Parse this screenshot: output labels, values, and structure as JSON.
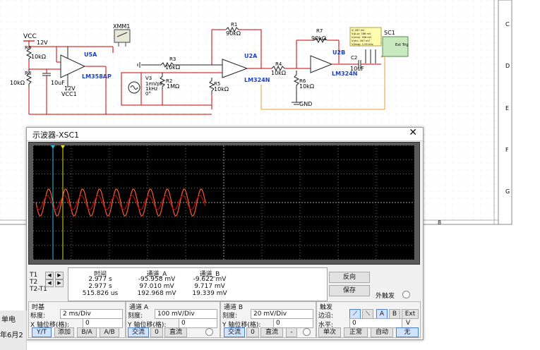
{
  "schematic": {
    "vcc_label": "VCC",
    "vcc_voltage": "12V",
    "r9": {
      "name": "R9",
      "value": "10kΩ"
    },
    "r8": {
      "name": "R8",
      "value": "10kΩ"
    },
    "c1": {
      "name": "C1",
      "value": "10uF"
    },
    "vcc1": {
      "voltage": "12V",
      "label": "VCC1"
    },
    "u5a": {
      "name": "U5A",
      "part": "LM358AP"
    },
    "xmm1": "XMM1",
    "r3": {
      "name": "R3",
      "value": "10kΩ"
    },
    "v3": {
      "name": "V3",
      "line1": "1mVpk",
      "line2": "1kHz",
      "line3": "0°"
    },
    "r2": {
      "name": "R2",
      "value": "1MΩ"
    },
    "r1": {
      "name": "R1",
      "value": "90kΩ"
    },
    "u2a": {
      "name": "U2A",
      "part": "LM324N"
    },
    "r5": {
      "name": "R5",
      "value": "10kΩ"
    },
    "r4": {
      "name": "R4",
      "value": "10kΩ"
    },
    "r7": {
      "name": "R7",
      "value": "90kΩ"
    },
    "u2b": {
      "name": "U2B",
      "part": "LM324N"
    },
    "r6": {
      "name": "R6",
      "value": "10kΩ"
    },
    "c2": {
      "name": "C2",
      "value": "10uF"
    },
    "gnd": "GND",
    "sc1": "SC1",
    "probe_lines": [
      "V: 267 mV",
      "V(p-p): 186 mV",
      "V(rms): 306 mV",
      "V(dc): 267 mV",
      "V(freq): 1.00 kHz"
    ],
    "ext_trig": "Ext Trig",
    "border_letters": [
      "C",
      "D",
      "E",
      "F",
      "G"
    ],
    "border_number": "8"
  },
  "scope": {
    "title": "示波器-XSC1",
    "close_icon": "✕",
    "cursor_colors": {
      "t1": "#20c8e8",
      "t2": "#e8e020"
    },
    "trace_colors": {
      "a": "#ff5a2a",
      "b": "#b01010"
    },
    "readout": {
      "headers": {
        "time": "时间",
        "ch_a": "通道_A",
        "ch_b": "通道_B"
      },
      "rows": [
        {
          "label": "T1",
          "time": "2.977 s",
          "a": "-95.958 mV",
          "b": "-9.622 mV"
        },
        {
          "label": "T2",
          "time": "2.977 s",
          "a": "97.010 mV",
          "b": "9.717 mV"
        },
        {
          "label": "T2-T1",
          "time": "515.826 us",
          "a": "192.968 mV",
          "b": "19.339 mV"
        }
      ]
    },
    "buttons": {
      "reverse": "反向",
      "save": "保存"
    },
    "ext_trigger_label": "外触发",
    "timebase": {
      "title": "时基",
      "scale_label": "标度:",
      "scale_value": "2 ms/Div",
      "xpos_label": "X 轴位移(格):",
      "xpos_value": "0",
      "yt": "Y/T",
      "add": "添加",
      "ba": "B/A",
      "ab": "A/B"
    },
    "channel_a": {
      "title": "通道 A",
      "scale_label": "刻度:",
      "scale_value": "100 mV/Div",
      "ypos_label": "Y 轴位移(格):",
      "ypos_value": "0",
      "ac": "交流",
      "zero": "0",
      "dc": "直流"
    },
    "channel_b": {
      "title": "通道 B",
      "scale_label": "刻度:",
      "scale_value": "20 mV/Div",
      "ypos_label": "Y 轴位移(格):",
      "ypos_value": "0",
      "ac": "交流",
      "zero": "0",
      "dc": "直流",
      "minus": "-"
    },
    "trigger": {
      "title": "触发",
      "edge_label": "边沿:",
      "level_label": "水平:",
      "level_value": "0",
      "level_unit": "V",
      "a": "A",
      "b": "B",
      "ext": "Ext",
      "single": "单次",
      "normal": "正常",
      "auto": "自动",
      "none": "无"
    }
  },
  "taskbar": {
    "left_text": "单电",
    "date_text": "年6月2"
  }
}
